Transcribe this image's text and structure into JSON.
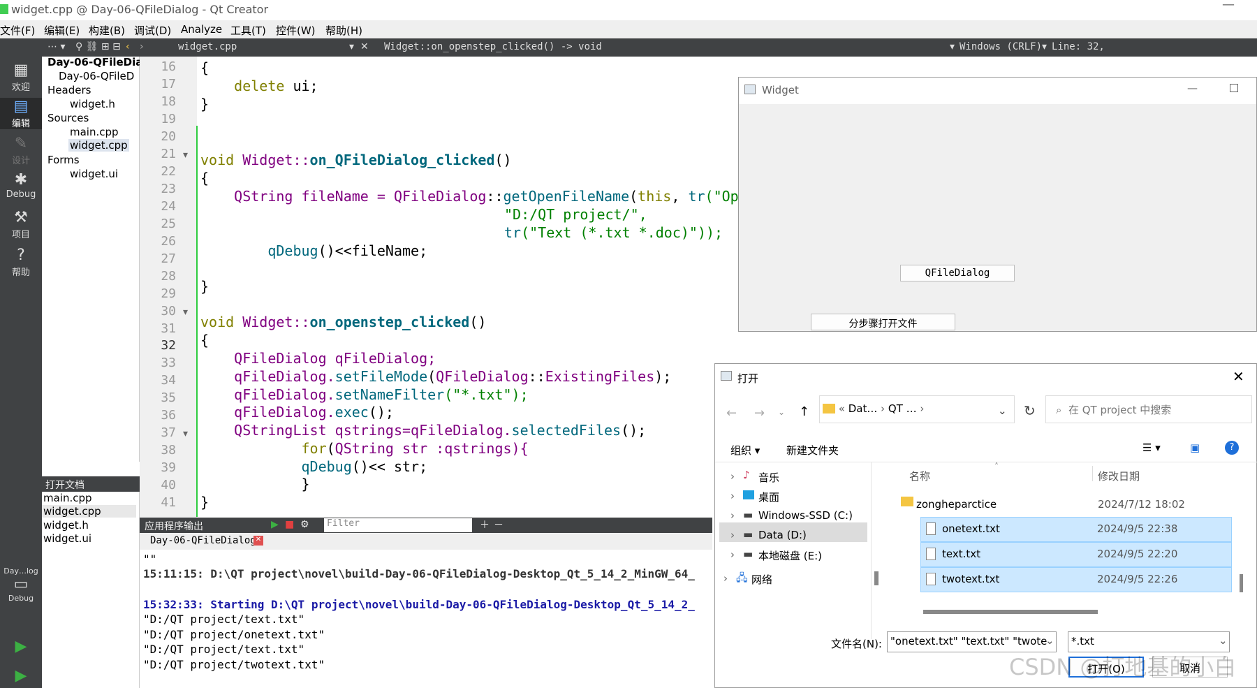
{
  "window": {
    "title": "widget.cpp @ Day-06-QFileDialog - Qt Creator",
    "minimize": "—"
  },
  "menu": [
    "文件(F)",
    "编辑(E)",
    "构建(B)",
    "调试(D)",
    "Analyze",
    "工具(T)",
    "控件(W)",
    "帮助(H)"
  ],
  "modes": [
    "欢迎",
    "编辑",
    "设计",
    "Debug",
    "项目",
    "帮助"
  ],
  "kit": {
    "name": "Day…log",
    "label": "Debug"
  },
  "toolbar": {
    "file": "widget.cpp",
    "function": "Widget::on_openstep_clicked() -> void",
    "eol": "Windows (CRLF)",
    "line": "Line: 32,"
  },
  "project_tree": {
    "root": "Day-06-QFileDia",
    "pro": "Day-06-QFileD",
    "headers": "Headers",
    "widget_h": "widget.h",
    "sources": "Sources",
    "main_cpp": "main.cpp",
    "widget_cpp": "widget.cpp",
    "forms": "Forms",
    "widget_ui": "widget.ui"
  },
  "open_docs": {
    "title": "打开文档",
    "items": [
      "main.cpp",
      "widget.cpp",
      "widget.h",
      "widget.ui"
    ]
  },
  "line_numbers": [
    "16",
    "17",
    "18",
    "19",
    "20",
    "21",
    "22",
    "23",
    "24",
    "25",
    "26",
    "27",
    "28",
    "29",
    "30",
    "31",
    "32",
    "33",
    "34",
    "35",
    "36",
    "37",
    "38",
    "39",
    "40",
    "41"
  ],
  "code": {
    "l16": "{",
    "l17a": "    delete",
    "l17b": " ui;",
    "l18": "}",
    "l21a": "void",
    "l21b": " Widget::",
    "l21c": "on_QFileDialog_clicked",
    "l21d": "()",
    "l22": "{",
    "l23a": "    QString",
    "l23b": " fileName = ",
    "l23c": "QFileDialog",
    "l23d": "::",
    "l23e": "getOpenFileName",
    "l23f": "(",
    "l23g": "this",
    "l23h": ", ",
    "l23i": "tr",
    "l23j": "(\"Op",
    "l24": "\"D:/QT project/\",",
    "l25a": "tr",
    "l25b": "(\"Text (*.txt *.doc)\"));",
    "l26a": "        qDebug",
    "l26b": "()<<fileName;",
    "l28": "}",
    "l30a": "void",
    "l30b": " Widget::",
    "l30c": "on_openstep_clicked",
    "l30d": "()",
    "l31": "{",
    "l32a": "    QFileDialog",
    "l32b": " qFileDialog;",
    "l33a": "    qFileDialog.",
    "l33b": "setFileMode",
    "l33c": "(",
    "l33d": "QFileDialog",
    "l33e": "::",
    "l33f": "ExistingFiles",
    "l33g": ");",
    "l34a": "    qFileDialog.",
    "l34b": "setNameFilter",
    "l34c": "(\"*.txt\");",
    "l35a": "    qFileDialog.",
    "l35b": "exec",
    "l35c": "();",
    "l36a": "    QStringList",
    "l36b": " qstrings=qFileDialog.",
    "l36c": "selectedFiles",
    "l36d": "();",
    "l37a": "            for",
    "l37b": "(",
    "l37c": "QString",
    "l37d": " str :qstrings){",
    "l38a": "            qDebug",
    "l38b": "()<< str;",
    "l39": "            }",
    "l40": "}"
  },
  "output": {
    "title": "应用程序输出",
    "filter_placeholder": "Filter",
    "tab": "Day-06-QFileDialog",
    "lines": [
      "\"\"",
      "15:11:15: D:\\QT project\\novel\\build-Day-06-QFileDialog-Desktop_Qt_5_14_2_MinGW_64_",
      "",
      "15:32:33: Starting D:\\QT project\\novel\\build-Day-06-QFileDialog-Desktop_Qt_5_14_2_",
      "\"D:/QT project/text.txt\"",
      "\"D:/QT project/onetext.txt\"",
      "\"D:/QT project/text.txt\"",
      "\"D:/QT project/twotext.txt\""
    ]
  },
  "widget_window": {
    "title": "Widget",
    "btn_qfiledialog": "QFileDialog",
    "btn_step": "分步骤打开文件"
  },
  "dialog": {
    "title": "打开",
    "path": [
      "Dat…",
      "QT …"
    ],
    "search_placeholder": "在 QT project 中搜索",
    "organize": "组织 ▾",
    "new_folder": "新建文件夹",
    "nav": [
      "音乐",
      "桌面",
      "Windows-SSD (C:)",
      "Data (D:)",
      "本地磁盘 (E:)",
      "网络"
    ],
    "col_name": "名称",
    "col_date": "修改日期",
    "files": [
      {
        "name": "zongheparctice",
        "date": "2024/7/12 18:02"
      },
      {
        "name": "onetext.txt",
        "date": "2024/9/5 22:38"
      },
      {
        "name": "text.txt",
        "date": "2024/9/5 22:20"
      },
      {
        "name": "twotext.txt",
        "date": "2024/9/5 22:26"
      }
    ],
    "filename_label": "文件名(N):",
    "filename_value": "\"onetext.txt\" \"text.txt\" \"twote",
    "filter_value": "*.txt",
    "open_btn": "打开(O)",
    "cancel_btn": "取消"
  },
  "watermark": "CSDN @打地基的小白"
}
